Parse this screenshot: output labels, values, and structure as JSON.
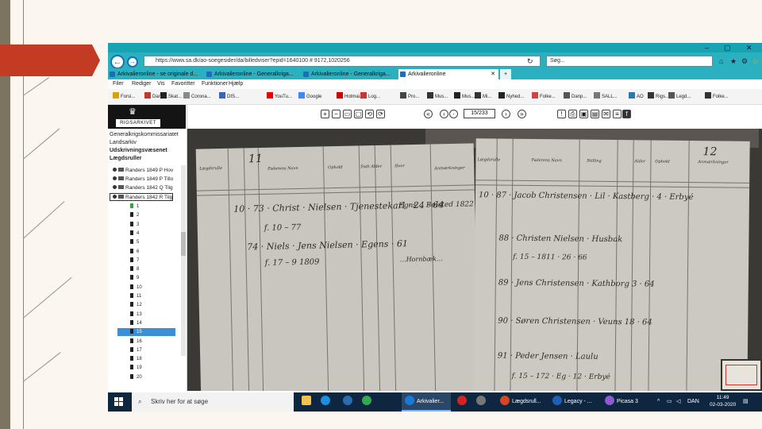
{
  "browser": {
    "url": "https://www.sa.dk/ao-soegesider/da/billedviser?epid=1640100 # 9172,1020256",
    "search_placeholder": "Søg...",
    "tabs": [
      {
        "label": "Arkivalieronline - se originale d..."
      },
      {
        "label": "Arkivalieronline - Generalkriga..."
      },
      {
        "label": "Arkivalieronline - Generalkriga..."
      },
      {
        "label": "Arkivalieronline"
      }
    ],
    "menu": [
      "Filer",
      "Rediger",
      "Vis",
      "Favoritter",
      "Funktioner",
      "Hjælp"
    ],
    "favorites": [
      "Forsi...",
      "Danic...",
      "Skat...",
      "Corona...",
      "DIS...",
      "YouTu...",
      "Google",
      "Hotmai...",
      "Log...",
      "Pro...",
      "Mus...",
      "Mus...",
      "Mi...",
      "Nyhed...",
      "Folke...",
      "Danp...",
      "SALL...",
      "AO",
      "Rigs...",
      "Legd...",
      "Folke..."
    ]
  },
  "sidebar": {
    "logo": "RIGSARKIVET",
    "breadcrumbs": [
      "Generalkrigskommissariatet",
      "Landsarkiv",
      "Udskrivningsvæsenet",
      "Lægdsruller"
    ],
    "tree": [
      "Randers 1849 P Hov",
      "Randers 1849 P Tillo",
      "Randers 1842 Q Tilg",
      "Randers 1842 R Tilg"
    ],
    "pages": [
      "1",
      "2",
      "3",
      "4",
      "5",
      "6",
      "7",
      "8",
      "9",
      "10",
      "11",
      "12",
      "13",
      "14",
      "15",
      "16",
      "17",
      "18",
      "19",
      "20"
    ],
    "selected_page": "15"
  },
  "viewer": {
    "page_counter": "15/233"
  },
  "document": {
    "page_numbers": [
      "11",
      "12"
    ],
    "left_headers": [
      "Lægdsrulle",
      "Faderens Navn",
      "Ophold",
      "Fodt Alder",
      "Hvor",
      "Udfald",
      "Anmærkninger"
    ],
    "right_headers": [
      "Lægdsrulle",
      "Faderens Navn",
      "Stilling",
      "Alder",
      "Ophold",
      "Anmærkninger"
    ]
  },
  "taskbar": {
    "search_placeholder": "Skriv her for at søge",
    "apps": [
      "Arkivalier...",
      "Lægdsrull...",
      "Legacy - ...",
      "Picasa 3"
    ],
    "lang": "DAN",
    "time": "11:49",
    "date": "02-03-2020"
  },
  "colors": {
    "titlebar": "#17a3b2",
    "slide_accent": "#c23b22",
    "taskbar": "#0f2641",
    "selection": "#3a8fd6"
  }
}
